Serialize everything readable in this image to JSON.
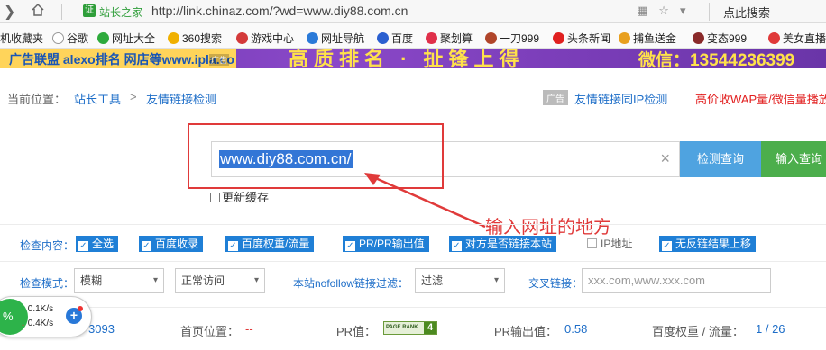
{
  "browser": {
    "site_name": "站长之家",
    "cert_label": "证",
    "url": "http://link.chinaz.com/?wd=www.diy88.com.cn",
    "search_label": "点此搜索"
  },
  "bookmarks": [
    {
      "label": "机收藏夹",
      "color": "#f5b400"
    },
    {
      "label": "谷歌",
      "color": "#ffffff"
    },
    {
      "label": "网址大全",
      "color": "#2eaa3c"
    },
    {
      "label": "360搜索",
      "color": "#f0b000"
    },
    {
      "label": "游戏中心",
      "color": "#d43a3a"
    },
    {
      "label": "网址导航",
      "color": "#2a7ad8"
    },
    {
      "label": "百度",
      "color": "#2a5fd0"
    },
    {
      "label": "聚划算",
      "color": "#e0304a"
    },
    {
      "label": "一刀999",
      "color": "#b0452a"
    },
    {
      "label": "头条新闻",
      "color": "#e02020"
    },
    {
      "label": "捕鱼送金",
      "color": "#e8a020"
    },
    {
      "label": "变态999",
      "color": "#8a2a2a"
    },
    {
      "label": "美女直播",
      "color": "#e03a3a"
    }
  ],
  "banner": {
    "left_text": "广告联盟 alexo排名 网店等www.ipla.co",
    "tag": "广告",
    "mid_text": "高质排名 · 扯锋上得",
    "wechat": "微信：13544236399"
  },
  "breadcrumb": {
    "label": "当前位置：",
    "level1": "站长工具",
    "separator": ">",
    "level2": "友情链接检测",
    "ad_tag": "广告",
    "link_right": "友情链接同IP检测",
    "promo_right": "高价收WAP量/微信量播放"
  },
  "search": {
    "value": "www.diy88.com.cn/",
    "clear_icon": "×",
    "check_button": "检测查询",
    "input_button": "输入查询",
    "cache_label": "更新缓存"
  },
  "annotation": {
    "text": "输入网址的地方",
    "color": "#e03a3a"
  },
  "options": {
    "label": "检查内容：",
    "items": [
      {
        "label": "全选",
        "checked": true
      },
      {
        "label": "百度收录",
        "checked": true
      },
      {
        "label": "百度权重/流量",
        "checked": true
      },
      {
        "label": "PR/PR输出值",
        "checked": true
      },
      {
        "label": "对方是否链接本站",
        "checked": true
      },
      {
        "label": "IP地址",
        "checked": false
      },
      {
        "label": "无反链结果上移",
        "checked": true
      }
    ]
  },
  "mode": {
    "label": "检查模式：",
    "mode_value": "模糊",
    "access_value": "正常访问",
    "nofollow_label": "本站nofollow链接过滤：",
    "nofollow_value": "过滤",
    "cross_label": "交叉链接：",
    "cross_placeholder": "xxx.com,www.xxx.com"
  },
  "results": {
    "count": "3093",
    "home_pos_label": "首页位置：",
    "home_pos_value": "--",
    "pr_label": "PR值：",
    "pr_badge_text": "PAGE RANK",
    "pr_value": "4",
    "pr_output_label": "PR输出值：",
    "pr_output_value": "0.58",
    "weight_label": "百度权重 / 流量：",
    "weight_value": "1 / 26"
  },
  "speed_widget": {
    "percent": "%",
    "upload": "0.1K/s",
    "download": "0.4K/s",
    "plus": "+"
  },
  "colors": {
    "link_blue": "#1e6ec8",
    "check_blue": "#1f7fd6",
    "button_blue": "#4fa3e0",
    "button_green": "#4cae4c",
    "annotation_red": "#e03a3a"
  }
}
